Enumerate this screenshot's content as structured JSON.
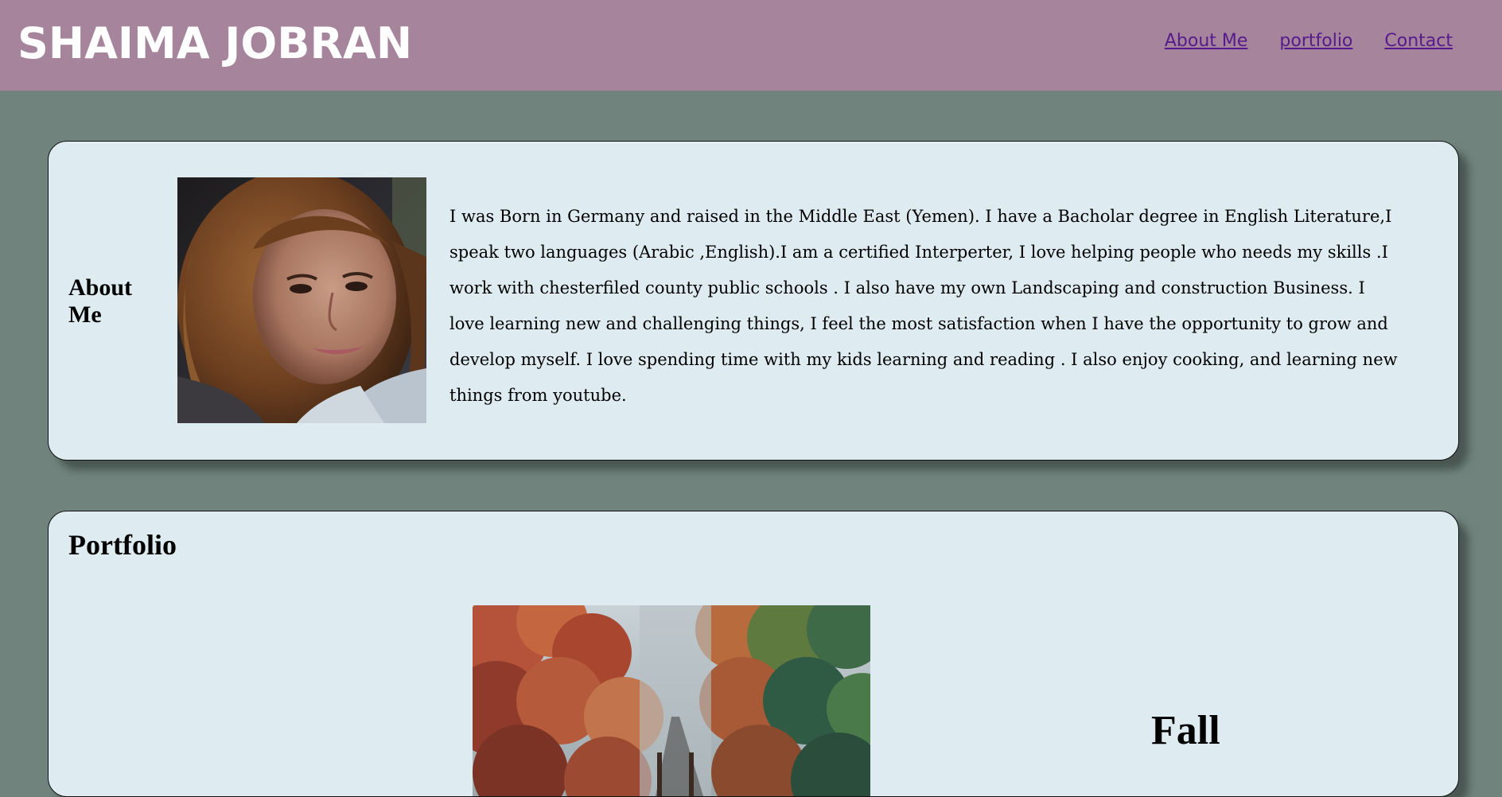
{
  "header": {
    "title": "SHAIMA JOBRAN",
    "nav": [
      "About Me",
      "portfolio",
      "Contact"
    ]
  },
  "about": {
    "heading_line1": "About",
    "heading_line2": "Me",
    "text": "I was Born in Germany and raised in the Middle East (Yemen). I have a Bacholar degree in English Literature,I speak two languages (Arabic ,English).I am a certified Interperter, I love helping people who needs my skills .I work with chesterfiled county public schools . I also have my own Landscaping and construction Business. I love learning new and challenging things, I feel the most satisfaction when I have the opportunity to grow and develop myself. I love spending time with my kids learning and reading . I also enjoy cooking, and learning new things from youtube."
  },
  "portfolio": {
    "heading": "Portfolio",
    "item_title": "Fall"
  },
  "colors": {
    "page_background": "#70847d",
    "header_background": "#a6849b",
    "card_background": "#deebf0",
    "nav_link": "#551a8b"
  }
}
